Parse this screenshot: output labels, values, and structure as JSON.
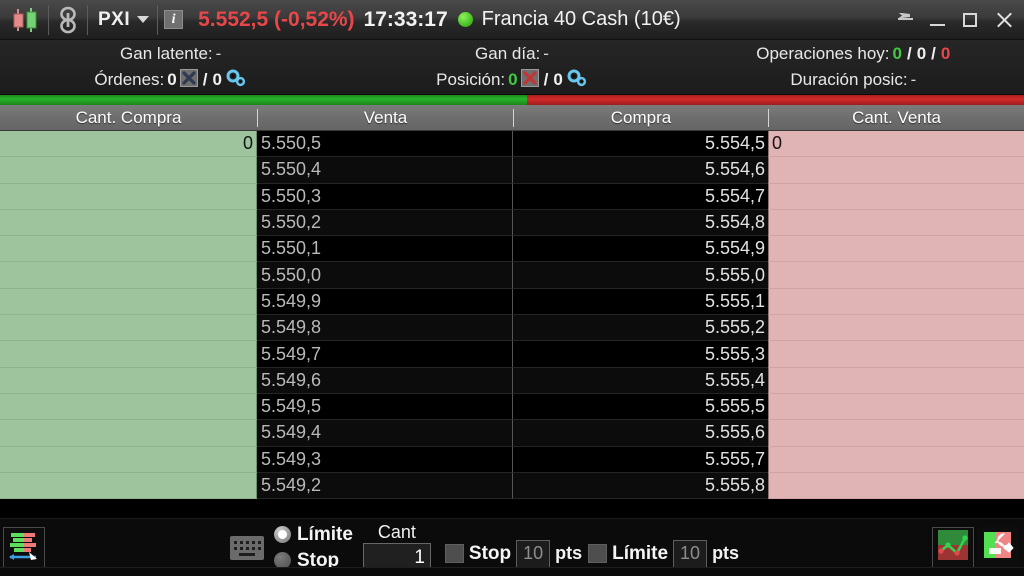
{
  "titlebar": {
    "candle_icon": "candlestick-icon",
    "chain_icon": "chain-link-icon",
    "workspace": "PXI",
    "info_glyph": "i",
    "last_price": "5.552,5 (-0,52%)",
    "clock": "17:33:17",
    "connection_status": "connected",
    "instrument": "Francia 40 Cash (10€)",
    "pin_label": "pin",
    "minimize_label": "minimize",
    "maximize_label": "maximize",
    "close_label": "close"
  },
  "info": {
    "gan_latente_label": "Gan latente:",
    "gan_latente_value": "-",
    "gan_dia_label": "Gan día:",
    "gan_dia_value": "-",
    "operaciones_label": "Operaciones hoy:",
    "operaciones_win": "0",
    "operaciones_mid": "0",
    "operaciones_loss": "0",
    "separator": "/",
    "ordenes_label": "Órdenes:",
    "ordenes_count": "0",
    "ordenes_pending": "0",
    "posicion_label": "Posición:",
    "posicion_count": "0",
    "posicion_pending": "0",
    "duracion_label": "Duración posic:",
    "duracion_value": "-"
  },
  "split_bar": {
    "green_pct": 51.5,
    "green_color": "#28b428",
    "red_color": "#d42b2b"
  },
  "columns": {
    "qty_buy": "Cant. Compra",
    "sell": "Venta",
    "buy": "Compra",
    "qty_sell": "Cant. Venta"
  },
  "ladder": {
    "rows": [
      {
        "qty_buy": "0",
        "sell": "5.550,5",
        "buy": "5.554,5",
        "qty_sell": "0"
      },
      {
        "qty_buy": "",
        "sell": "5.550,4",
        "buy": "5.554,6",
        "qty_sell": ""
      },
      {
        "qty_buy": "",
        "sell": "5.550,3",
        "buy": "5.554,7",
        "qty_sell": ""
      },
      {
        "qty_buy": "",
        "sell": "5.550,2",
        "buy": "5.554,8",
        "qty_sell": ""
      },
      {
        "qty_buy": "",
        "sell": "5.550,1",
        "buy": "5.554,9",
        "qty_sell": ""
      },
      {
        "qty_buy": "",
        "sell": "5.550,0",
        "buy": "5.555,0",
        "qty_sell": ""
      },
      {
        "qty_buy": "",
        "sell": "5.549,9",
        "buy": "5.555,1",
        "qty_sell": ""
      },
      {
        "qty_buy": "",
        "sell": "5.549,8",
        "buy": "5.555,2",
        "qty_sell": ""
      },
      {
        "qty_buy": "",
        "sell": "5.549,7",
        "buy": "5.555,3",
        "qty_sell": ""
      },
      {
        "qty_buy": "",
        "sell": "5.549,6",
        "buy": "5.555,4",
        "qty_sell": ""
      },
      {
        "qty_buy": "",
        "sell": "5.549,5",
        "buy": "5.555,5",
        "qty_sell": ""
      },
      {
        "qty_buy": "",
        "sell": "5.549,4",
        "buy": "5.555,6",
        "qty_sell": ""
      },
      {
        "qty_buy": "",
        "sell": "5.549,3",
        "buy": "5.555,7",
        "qty_sell": ""
      },
      {
        "qty_buy": "",
        "sell": "5.549,2",
        "buy": "5.555,8",
        "qty_sell": ""
      }
    ]
  },
  "bottombar": {
    "dom_icon": "depth-of-market-icon",
    "keyboard_icon": "keyboard-icon",
    "limite_label": "Límite",
    "stop_label": "Stop",
    "order_type_selected": "Límite",
    "cant_caption": "Cant",
    "cant_value": "1",
    "stop_check_label": "Stop",
    "stop_pts_value": "10",
    "stop_pts_unit": "pts",
    "limite_check_label": "Límite",
    "limite_pts_value": "10",
    "limite_pts_unit": "pts",
    "chart_icon": "line-chart-icon",
    "tools_icon": "wrench-tools-icon"
  },
  "colors": {
    "bid_green": "#9ec49e",
    "ask_pink": "#e0b4b4",
    "price_down_red": "#e8474a",
    "positive_green": "#41c941"
  }
}
